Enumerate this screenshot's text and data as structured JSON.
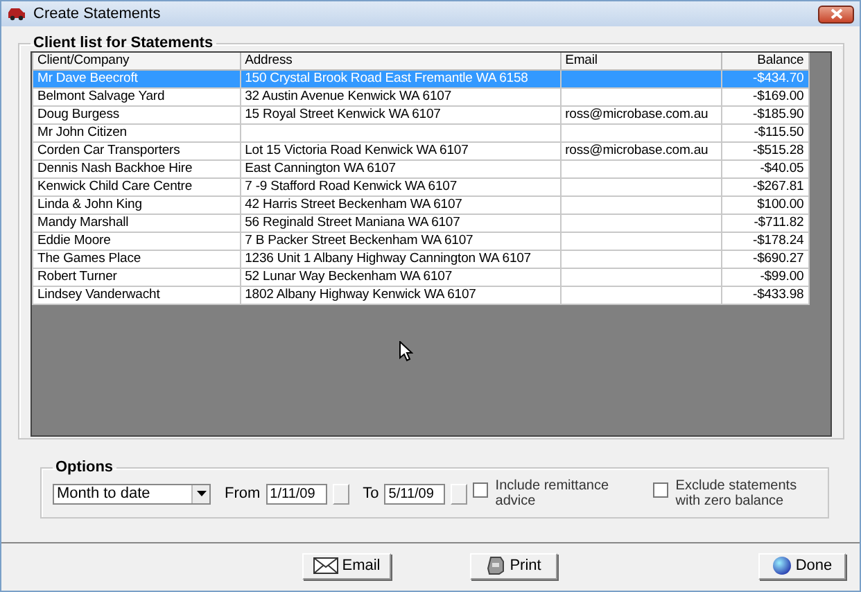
{
  "window": {
    "title": "Create Statements"
  },
  "client_list": {
    "title": "Client list for Statements",
    "columns": [
      "Client/Company",
      "Address",
      "Email",
      "Balance"
    ],
    "rows": [
      {
        "client": "Mr Dave Beecroft",
        "address": "150 Crystal Brook Road East Fremantle WA 6158",
        "email": "",
        "balance": "-$434.70",
        "selected": true
      },
      {
        "client": "Belmont Salvage Yard",
        "address": "32 Austin Avenue Kenwick WA 6107",
        "email": "",
        "balance": "-$169.00",
        "selected": false
      },
      {
        "client": "Doug Burgess",
        "address": "15 Royal Street Kenwick WA 6107",
        "email": "ross@microbase.com.au",
        "balance": "-$185.90",
        "selected": false
      },
      {
        "client": "Mr John Citizen",
        "address": "",
        "email": "",
        "balance": "-$115.50",
        "selected": false
      },
      {
        "client": "Corden Car Transporters",
        "address": "Lot 15 Victoria Road Kenwick WA 6107",
        "email": "ross@microbase.com.au",
        "balance": "-$515.28",
        "selected": false
      },
      {
        "client": "Dennis Nash Backhoe Hire",
        "address": "East Cannington WA 6107",
        "email": "",
        "balance": "-$40.05",
        "selected": false
      },
      {
        "client": "Kenwick Child Care Centre",
        "address": "7 -9 Stafford Road Kenwick WA 6107",
        "email": "",
        "balance": "-$267.81",
        "selected": false
      },
      {
        "client": "Linda & John King",
        "address": "42 Harris Street Beckenham WA 6107",
        "email": "",
        "balance": "$100.00",
        "selected": false
      },
      {
        "client": "Mandy Marshall",
        "address": "56 Reginald Street Maniana WA 6107",
        "email": "",
        "balance": "-$711.82",
        "selected": false
      },
      {
        "client": "Eddie Moore",
        "address": "7 B Packer Street Beckenham WA 6107",
        "email": "",
        "balance": "-$178.24",
        "selected": false
      },
      {
        "client": "The Games Place",
        "address": "1236 Unit 1 Albany Highway Cannington WA 6107",
        "email": "",
        "balance": "-$690.27",
        "selected": false
      },
      {
        "client": "Robert Turner",
        "address": "52 Lunar Way Beckenham WA 6107",
        "email": "",
        "balance": "-$99.00",
        "selected": false
      },
      {
        "client": "Lindsey Vanderwacht",
        "address": "1802 Albany Highway Kenwick WA 6107",
        "email": "",
        "balance": "-$433.98",
        "selected": false
      }
    ]
  },
  "options": {
    "title": "Options",
    "period": "Month to date",
    "from_label": "From",
    "from": "1/11/09",
    "to_label": "To",
    "to": "5/11/09",
    "checkboxes": [
      {
        "label": "Include remittance advice",
        "checked": false
      },
      {
        "label": "Exclude statements with zero balance",
        "checked": false
      }
    ]
  },
  "buttons": [
    {
      "kind": "email",
      "label": "Email"
    },
    {
      "kind": "print",
      "label": "Print"
    },
    {
      "kind": "done",
      "label": "Done"
    }
  ]
}
